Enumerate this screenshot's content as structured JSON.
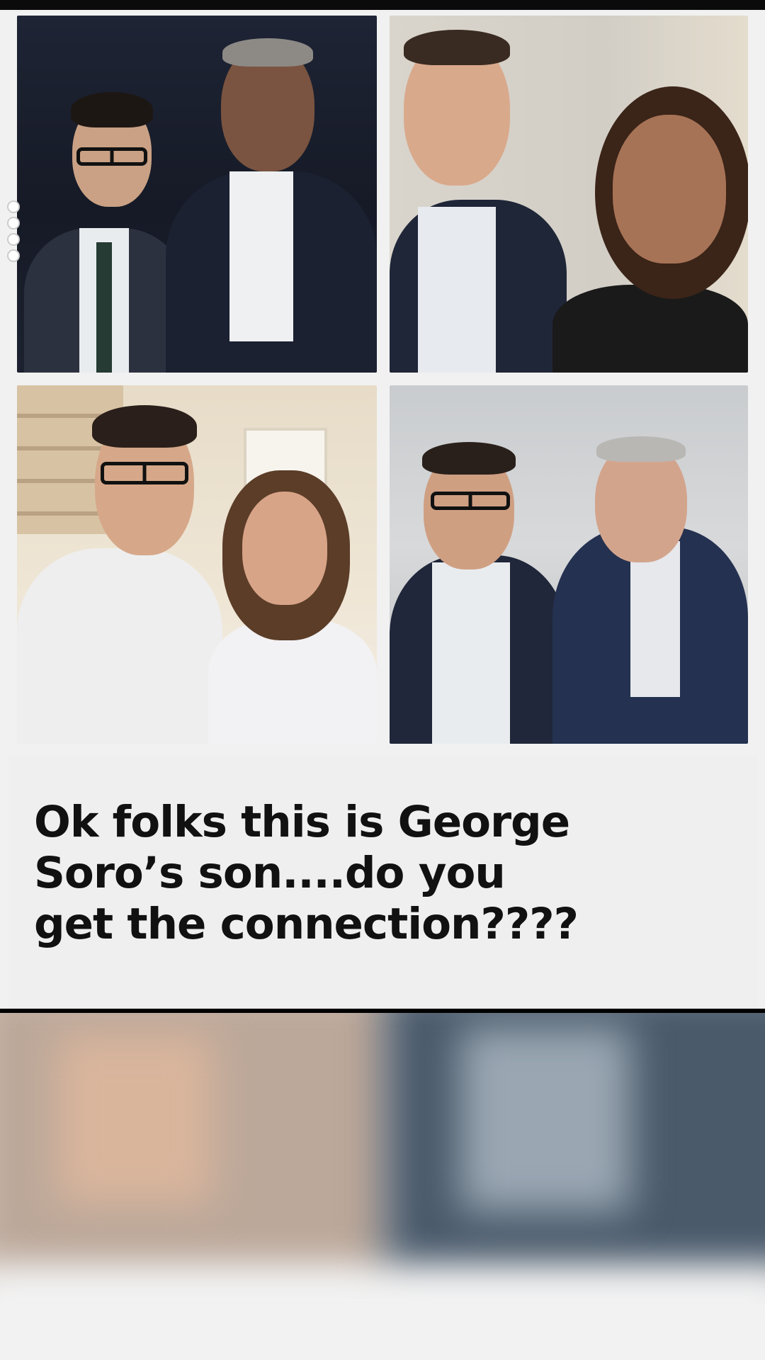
{
  "post": {
    "caption": "Ok folks this is George Soro’s son....do you get the connection????",
    "caption_lines": [
      "Ok folks this is George",
      "Soro’s son....do you",
      "get the connection????"
    ]
  },
  "photos": [
    {
      "name": "photo-top-left"
    },
    {
      "name": "photo-top-right"
    },
    {
      "name": "photo-bottom-left"
    },
    {
      "name": "photo-bottom-right"
    }
  ],
  "page_indicator": {
    "count": 4
  },
  "colors": {
    "background": "#000000",
    "card": "#f1f1f1",
    "caption_text": "#111111"
  }
}
